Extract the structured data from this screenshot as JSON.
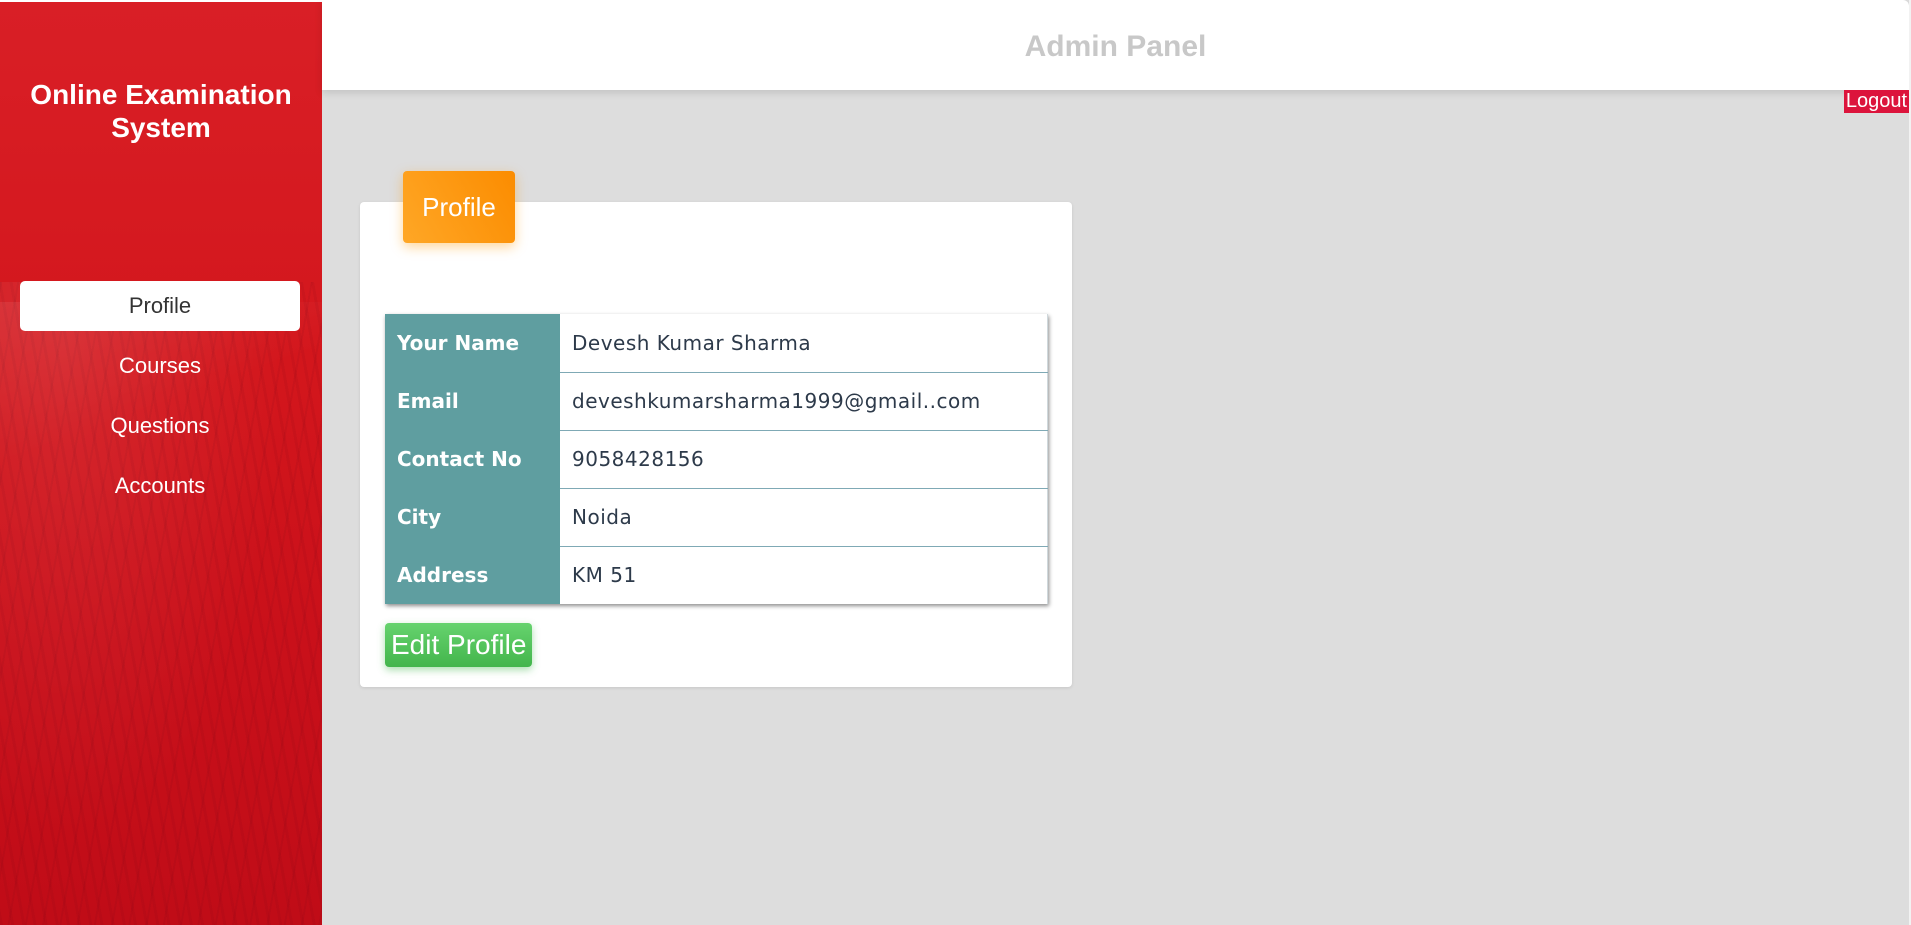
{
  "sidebar": {
    "app_title_line1": "Online Examination",
    "app_title_line2": "System",
    "items": [
      {
        "label": "Profile",
        "active": true
      },
      {
        "label": "Courses",
        "active": false
      },
      {
        "label": "Questions",
        "active": false
      },
      {
        "label": "Accounts",
        "active": false
      }
    ]
  },
  "header": {
    "title": "Admin Panel",
    "logout_label": "Logout"
  },
  "profile_card": {
    "header_label": "Profile",
    "rows": [
      {
        "label": "Your Name",
        "value": "Devesh Kumar Sharma"
      },
      {
        "label": "Email",
        "value": "deveshkumarsharma1999@gmail..com"
      },
      {
        "label": "Contact No",
        "value": "9058428156"
      },
      {
        "label": "City",
        "value": "Noida"
      },
      {
        "label": "Address",
        "value": "KM 51"
      }
    ],
    "edit_button_label": "Edit Profile"
  },
  "colors": {
    "sidebar_red": "#d3161c",
    "card_header_orange": "#fb8c00",
    "table_label_teal": "#5f9ea0",
    "edit_button_green": "#4cbb55",
    "logout_crimson": "#dc143c",
    "background_gray": "#dddddd"
  }
}
